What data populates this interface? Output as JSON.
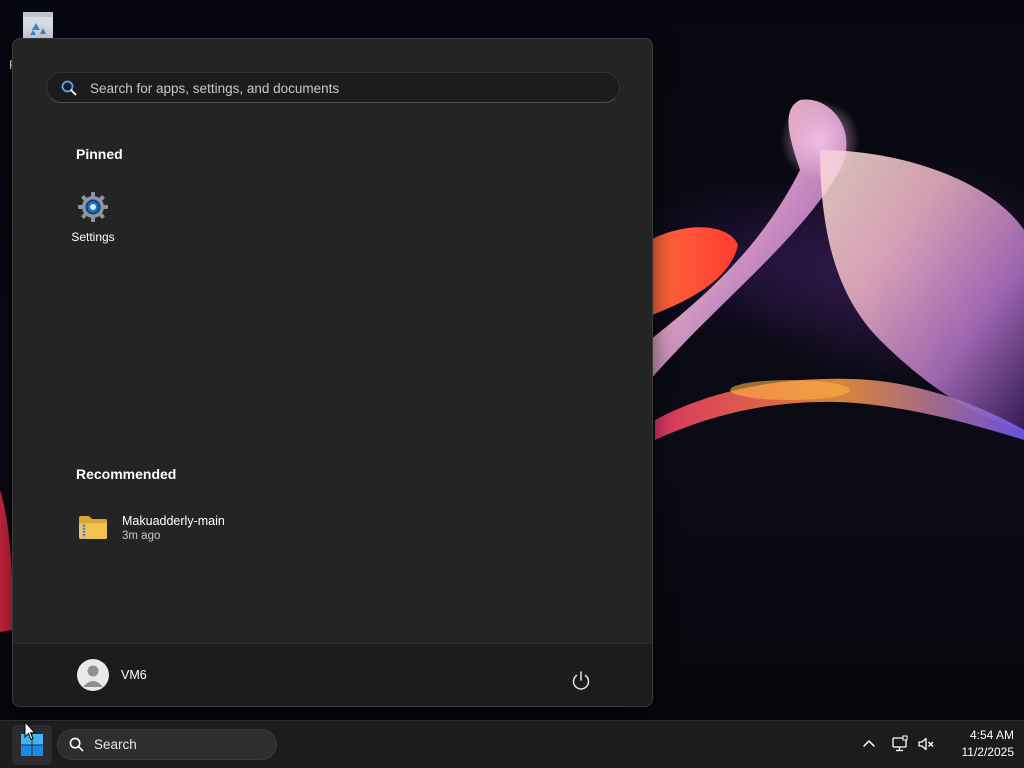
{
  "desktop": {
    "recycle_bin_label": "R"
  },
  "start_menu": {
    "search": {
      "placeholder": "Search for apps, settings, and documents"
    },
    "pinned": {
      "title": "Pinned",
      "apps": [
        {
          "label": "Settings",
          "icon": "gear-icon"
        }
      ]
    },
    "recommended": {
      "title": "Recommended",
      "items": [
        {
          "name": "Makuadderly-main",
          "time": "3m ago",
          "icon": "zip-folder-icon"
        }
      ]
    },
    "footer": {
      "user_name": "VM6",
      "power_icon": "power-icon"
    }
  },
  "taskbar": {
    "search_label": "Search",
    "tray": {
      "icons": [
        "chevron-up-icon",
        "network-icon",
        "volume-muted-icon"
      ]
    },
    "clock": {
      "time": "4:54 AM",
      "date": "11/2/2025"
    }
  },
  "colors": {
    "menu_bg": "#242424",
    "footer_bg": "#1c1c1c",
    "taskbar_bg": "#1c1c1f",
    "accent_blue": "#0a78d4",
    "folder_yellow": "#f2c44e"
  }
}
